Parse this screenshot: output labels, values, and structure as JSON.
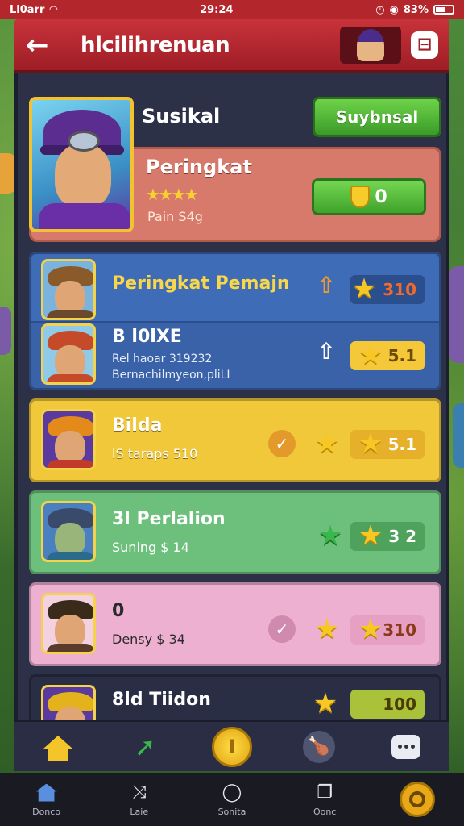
{
  "status_bar": {
    "carrier": "Ll0arr",
    "time": "29:24",
    "battery": "83%"
  },
  "header": {
    "title": "hlcilihrenuan"
  },
  "profile": {
    "name": "Susikal",
    "subscribe_label": "Suybnsal",
    "rank_title": "Peringkat",
    "rank_stars": "★★★★",
    "rank_sub": "Pain S4g",
    "coin_value": "0"
  },
  "rows": [
    {
      "title": "Peringkat Pemajn",
      "score": "310"
    },
    {
      "title": "B l0lXE",
      "sub": "Rel haoar 319232",
      "sub2": "Bernachilmyeon,pliLI",
      "score": "5.1"
    },
    {
      "title": "Bilda",
      "sub": "lS taraps 510",
      "score": "5.1"
    },
    {
      "title": "3l Perlalion",
      "sub": "Suning $ 14",
      "score": "3 2"
    },
    {
      "title": "0",
      "sub": "Densy $ 34",
      "score": "310"
    },
    {
      "title": "8ld Tiidon",
      "score": "100"
    }
  ],
  "tab_bar": [
    {
      "label": "Donco"
    },
    {
      "label": "Laie"
    },
    {
      "label": "Sonita"
    },
    {
      "label": "Oonc"
    }
  ],
  "colors": {
    "header_red": "#c9323a",
    "accent_green": "#3fa32b",
    "gold": "#f7c823"
  }
}
